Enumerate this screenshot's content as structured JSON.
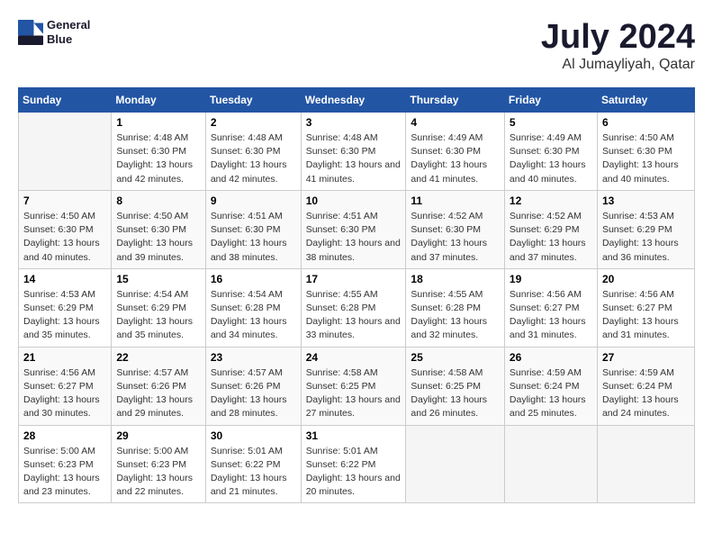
{
  "header": {
    "logo_line1": "General",
    "logo_line2": "Blue",
    "title": "July 2024",
    "subtitle": "Al Jumayliyah, Qatar"
  },
  "days_of_week": [
    "Sunday",
    "Monday",
    "Tuesday",
    "Wednesday",
    "Thursday",
    "Friday",
    "Saturday"
  ],
  "weeks": [
    [
      {
        "num": "",
        "sunrise": "",
        "sunset": "",
        "daylight": ""
      },
      {
        "num": "1",
        "sunrise": "Sunrise: 4:48 AM",
        "sunset": "Sunset: 6:30 PM",
        "daylight": "Daylight: 13 hours and 42 minutes."
      },
      {
        "num": "2",
        "sunrise": "Sunrise: 4:48 AM",
        "sunset": "Sunset: 6:30 PM",
        "daylight": "Daylight: 13 hours and 42 minutes."
      },
      {
        "num": "3",
        "sunrise": "Sunrise: 4:48 AM",
        "sunset": "Sunset: 6:30 PM",
        "daylight": "Daylight: 13 hours and 41 minutes."
      },
      {
        "num": "4",
        "sunrise": "Sunrise: 4:49 AM",
        "sunset": "Sunset: 6:30 PM",
        "daylight": "Daylight: 13 hours and 41 minutes."
      },
      {
        "num": "5",
        "sunrise": "Sunrise: 4:49 AM",
        "sunset": "Sunset: 6:30 PM",
        "daylight": "Daylight: 13 hours and 40 minutes."
      },
      {
        "num": "6",
        "sunrise": "Sunrise: 4:50 AM",
        "sunset": "Sunset: 6:30 PM",
        "daylight": "Daylight: 13 hours and 40 minutes."
      }
    ],
    [
      {
        "num": "7",
        "sunrise": "Sunrise: 4:50 AM",
        "sunset": "Sunset: 6:30 PM",
        "daylight": "Daylight: 13 hours and 40 minutes."
      },
      {
        "num": "8",
        "sunrise": "Sunrise: 4:50 AM",
        "sunset": "Sunset: 6:30 PM",
        "daylight": "Daylight: 13 hours and 39 minutes."
      },
      {
        "num": "9",
        "sunrise": "Sunrise: 4:51 AM",
        "sunset": "Sunset: 6:30 PM",
        "daylight": "Daylight: 13 hours and 38 minutes."
      },
      {
        "num": "10",
        "sunrise": "Sunrise: 4:51 AM",
        "sunset": "Sunset: 6:30 PM",
        "daylight": "Daylight: 13 hours and 38 minutes."
      },
      {
        "num": "11",
        "sunrise": "Sunrise: 4:52 AM",
        "sunset": "Sunset: 6:30 PM",
        "daylight": "Daylight: 13 hours and 37 minutes."
      },
      {
        "num": "12",
        "sunrise": "Sunrise: 4:52 AM",
        "sunset": "Sunset: 6:29 PM",
        "daylight": "Daylight: 13 hours and 37 minutes."
      },
      {
        "num": "13",
        "sunrise": "Sunrise: 4:53 AM",
        "sunset": "Sunset: 6:29 PM",
        "daylight": "Daylight: 13 hours and 36 minutes."
      }
    ],
    [
      {
        "num": "14",
        "sunrise": "Sunrise: 4:53 AM",
        "sunset": "Sunset: 6:29 PM",
        "daylight": "Daylight: 13 hours and 35 minutes."
      },
      {
        "num": "15",
        "sunrise": "Sunrise: 4:54 AM",
        "sunset": "Sunset: 6:29 PM",
        "daylight": "Daylight: 13 hours and 35 minutes."
      },
      {
        "num": "16",
        "sunrise": "Sunrise: 4:54 AM",
        "sunset": "Sunset: 6:28 PM",
        "daylight": "Daylight: 13 hours and 34 minutes."
      },
      {
        "num": "17",
        "sunrise": "Sunrise: 4:55 AM",
        "sunset": "Sunset: 6:28 PM",
        "daylight": "Daylight: 13 hours and 33 minutes."
      },
      {
        "num": "18",
        "sunrise": "Sunrise: 4:55 AM",
        "sunset": "Sunset: 6:28 PM",
        "daylight": "Daylight: 13 hours and 32 minutes."
      },
      {
        "num": "19",
        "sunrise": "Sunrise: 4:56 AM",
        "sunset": "Sunset: 6:27 PM",
        "daylight": "Daylight: 13 hours and 31 minutes."
      },
      {
        "num": "20",
        "sunrise": "Sunrise: 4:56 AM",
        "sunset": "Sunset: 6:27 PM",
        "daylight": "Daylight: 13 hours and 31 minutes."
      }
    ],
    [
      {
        "num": "21",
        "sunrise": "Sunrise: 4:56 AM",
        "sunset": "Sunset: 6:27 PM",
        "daylight": "Daylight: 13 hours and 30 minutes."
      },
      {
        "num": "22",
        "sunrise": "Sunrise: 4:57 AM",
        "sunset": "Sunset: 6:26 PM",
        "daylight": "Daylight: 13 hours and 29 minutes."
      },
      {
        "num": "23",
        "sunrise": "Sunrise: 4:57 AM",
        "sunset": "Sunset: 6:26 PM",
        "daylight": "Daylight: 13 hours and 28 minutes."
      },
      {
        "num": "24",
        "sunrise": "Sunrise: 4:58 AM",
        "sunset": "Sunset: 6:25 PM",
        "daylight": "Daylight: 13 hours and 27 minutes."
      },
      {
        "num": "25",
        "sunrise": "Sunrise: 4:58 AM",
        "sunset": "Sunset: 6:25 PM",
        "daylight": "Daylight: 13 hours and 26 minutes."
      },
      {
        "num": "26",
        "sunrise": "Sunrise: 4:59 AM",
        "sunset": "Sunset: 6:24 PM",
        "daylight": "Daylight: 13 hours and 25 minutes."
      },
      {
        "num": "27",
        "sunrise": "Sunrise: 4:59 AM",
        "sunset": "Sunset: 6:24 PM",
        "daylight": "Daylight: 13 hours and 24 minutes."
      }
    ],
    [
      {
        "num": "28",
        "sunrise": "Sunrise: 5:00 AM",
        "sunset": "Sunset: 6:23 PM",
        "daylight": "Daylight: 13 hours and 23 minutes."
      },
      {
        "num": "29",
        "sunrise": "Sunrise: 5:00 AM",
        "sunset": "Sunset: 6:23 PM",
        "daylight": "Daylight: 13 hours and 22 minutes."
      },
      {
        "num": "30",
        "sunrise": "Sunrise: 5:01 AM",
        "sunset": "Sunset: 6:22 PM",
        "daylight": "Daylight: 13 hours and 21 minutes."
      },
      {
        "num": "31",
        "sunrise": "Sunrise: 5:01 AM",
        "sunset": "Sunset: 6:22 PM",
        "daylight": "Daylight: 13 hours and 20 minutes."
      },
      {
        "num": "",
        "sunrise": "",
        "sunset": "",
        "daylight": ""
      },
      {
        "num": "",
        "sunrise": "",
        "sunset": "",
        "daylight": ""
      },
      {
        "num": "",
        "sunrise": "",
        "sunset": "",
        "daylight": ""
      }
    ]
  ]
}
